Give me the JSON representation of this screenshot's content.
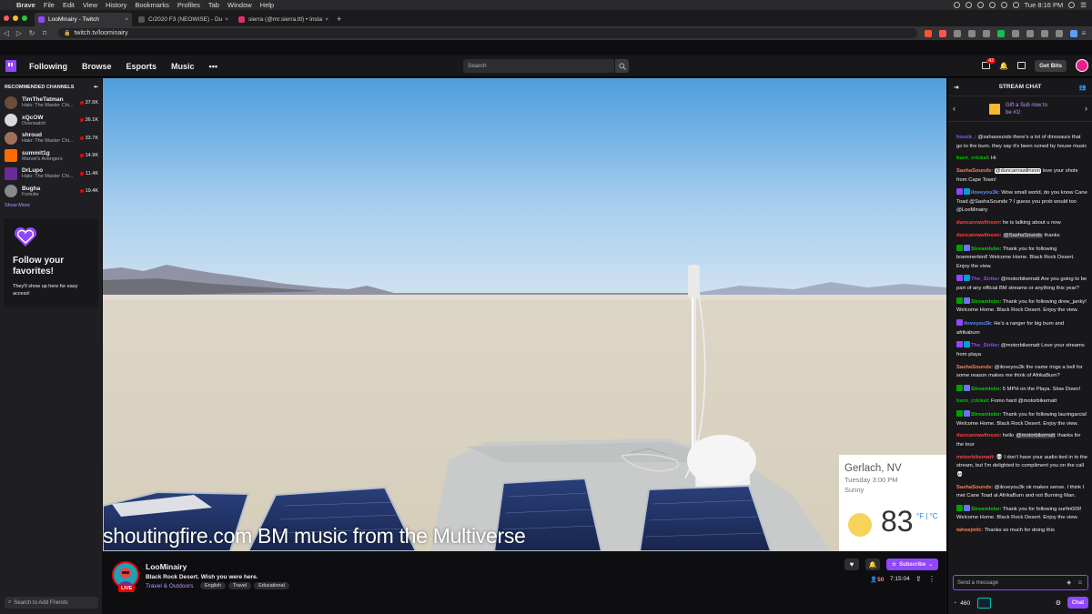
{
  "menubar": {
    "app": "Brave",
    "items": [
      "File",
      "Edit",
      "View",
      "History",
      "Bookmarks",
      "Profiles",
      "Tab",
      "Window",
      "Help"
    ],
    "clock": "Tue 8:16 PM"
  },
  "tabs": [
    {
      "title": "LooMinairy - Twitch",
      "color": "#9147ff"
    },
    {
      "title": "C/2020 F3 (NEOWISE) - Duncan",
      "color": "#555555"
    },
    {
      "title": "sierra (@mr.sierra.ttl) • Instagra",
      "color": "#e1306c"
    }
  ],
  "url": "twitch.tv/loominairy",
  "twitch_nav": {
    "items": [
      "Following",
      "Browse",
      "Esports",
      "Music"
    ],
    "more": "•••",
    "search_placeholder": "Search",
    "notification_count": "42",
    "get_bits": "Get Bits"
  },
  "sidebar": {
    "header": "RECOMMENDED CHANNELS",
    "channels": [
      {
        "name": "TimTheTatman",
        "game": "Halo: The Master Chi...",
        "viewers": "37.6K",
        "color": "#6b4b3a"
      },
      {
        "name": "xQcOW",
        "game": "Overwatch",
        "viewers": "36.1K",
        "color": "#d9d9d9"
      },
      {
        "name": "shroud",
        "game": "Halo: The Master Chi...",
        "viewers": "33.7K",
        "color": "#a0705a"
      },
      {
        "name": "summit1g",
        "game": "Marvel's Avengers",
        "viewers": "14.9K",
        "color": "#ff6a00"
      },
      {
        "name": "DrLupo",
        "game": "Halo: The Master Chi...",
        "viewers": "11.4K",
        "color": "#6a2a9a"
      },
      {
        "name": "Bugha",
        "game": "Fortnite",
        "viewers": "19.4K",
        "color": "#888888"
      }
    ],
    "show_more": "Show More",
    "promo": {
      "title": "Follow your favorites!",
      "body": "They'll show up here for easy access!"
    },
    "search_friends": "Search to Add Friends"
  },
  "video": {
    "caption": "shoutingfire.com BM music from the Multiverse",
    "weather": {
      "city": "Gerlach, NV",
      "when": "Tuesday 3:00 PM",
      "condition": "Sunny",
      "temp": "83",
      "units": "°F | °C"
    }
  },
  "stream_info": {
    "streamer": "LooMinairy",
    "title": "Black Rock Desert. Wish you were here.",
    "category": "Travel & Outdoors",
    "tags": [
      "English",
      "Travel",
      "Educational"
    ],
    "live": "LIVE",
    "viewers": "50",
    "uptime": "7:15:04",
    "subscribe": "Subscribe"
  },
  "chat": {
    "header": "STREAM CHAT",
    "gift_text": "Gift a Sub now to be #1!",
    "placeholder": "Send a message",
    "points": "460",
    "chat_button": "Chat",
    "messages": [
      {
        "user": "houck_",
        "color": "#8a5cf5",
        "text": ": @sahasounds there's a lot of dinosaurs that go to the burn. they say it's been ruined by house music"
      },
      {
        "user": "burn_cricket",
        "color": "#00c800",
        "text": ": Hi"
      },
      {
        "user": "SashaSounds",
        "color": "#ff7f50",
        "mention": "@duncanrawlinson",
        "text": " love your shots from Cape Town!"
      },
      {
        "user": "iloveyou3k",
        "color": "#5b8cff",
        "badges": [
          "#9147ff",
          "#00a0d0"
        ],
        "text": ": Wow small world, do you know Cane Toad @SashaSounds ? I guess you prob would too @LooMinairy"
      },
      {
        "user": "duncanrawlinson",
        "color": "#ff4040",
        "text": ": he is talking about u now"
      },
      {
        "user": "duncanrawlinson",
        "color": "#ff4040",
        "mention_dark": "@SashaSounds",
        "text": " thanks"
      },
      {
        "user": "StreamIsbo",
        "color": "#00d000",
        "badges": [
          "#00a000",
          "#7070ff"
        ],
        "text": ": Thank you for following brammerbird! Welcome Home. Black Rock Desert. Enjoy the view."
      },
      {
        "user": "The_Strike",
        "color": "#9147ff",
        "badges": [
          "#9147ff",
          "#00a0d0"
        ],
        "text": ": @motorbikematt Are you going to be part of any official BM streams or anything this year?"
      },
      {
        "user": "StreamIsbo",
        "color": "#00d000",
        "badges": [
          "#00a000",
          "#7070ff"
        ],
        "text": ": Thank you for following drew_janky! Welcome Home. Black Rock Desert. Enjoy the view."
      },
      {
        "user": "iloveyou3k",
        "color": "#5b8cff",
        "badges": [
          "#9147ff"
        ],
        "text": ": He's a ranger for big burn and afrikaburn"
      },
      {
        "user": "The_Strike",
        "color": "#9147ff",
        "badges": [
          "#9147ff",
          "#00a0d0"
        ],
        "text": ": @motorbikematt Love your streams from playa"
      },
      {
        "user": "SashaSounds",
        "color": "#ff7f50",
        "text": ": @iloveyou3k the name rings a bell for some reason makes me think of AfrikaBurn?"
      },
      {
        "user": "StreamIsbo",
        "color": "#00d000",
        "badges": [
          "#00a000",
          "#7070ff"
        ],
        "text": ": 5 MPH on the Playa. Slow Down!"
      },
      {
        "user": "burn_cricket",
        "color": "#00c800",
        "text": ": Fomo hard @motorbikematt"
      },
      {
        "user": "StreamIsbo",
        "color": "#00d000",
        "badges": [
          "#00a000",
          "#7070ff"
        ],
        "text": ": Thank you for following lauringarcia! Welcome Home. Black Rock Desert. Enjoy the view."
      },
      {
        "user": "duncanrawlinson",
        "color": "#ff4040",
        "text": ": hello ",
        "mention_dark": "@motorbikematt",
        "text2": " thanks for the tour"
      },
      {
        "user": "motorbikematt",
        "color": "#ff4040",
        "text": ": 💀 I don't have your audio tied in to the stream, but I'm delighted to compliment you on the call 💀"
      },
      {
        "user": "SashaSounds",
        "color": "#ff7f50",
        "text": ": @iloveyou3k ok makes sense. I think I met Cane Toad at AfrikaBurn and not Burning Man."
      },
      {
        "user": "StreamIsbo",
        "color": "#00d000",
        "badges": [
          "#00a000",
          "#7070ff"
        ],
        "text": ": Thank you for following surfin009! Welcome Home. Black Rock Desert. Enjoy the view."
      },
      {
        "user": "tahoejmfc",
        "color": "#ff7f50",
        "text": ": Thanks so much for doing this"
      }
    ]
  }
}
